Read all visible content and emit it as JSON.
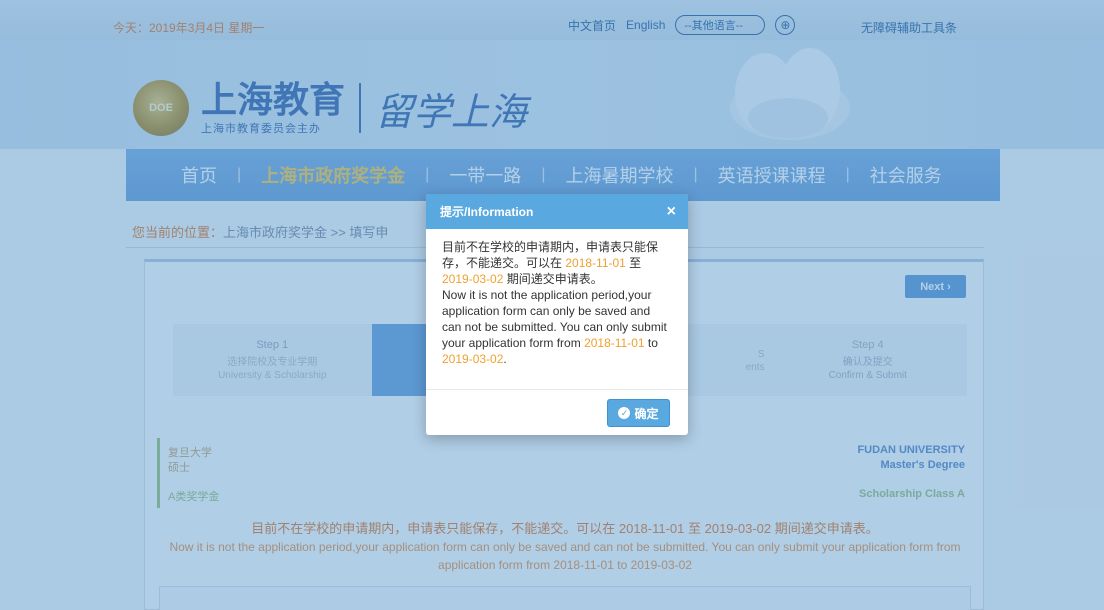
{
  "topbar": {
    "date": "今天：2019年3月4日 星期一",
    "home_cn": "中文首页",
    "english": "English",
    "other_lang": "--其他语言--",
    "accessible_tool": "无障碍辅助工具条"
  },
  "banner": {
    "emblem_text": "DOE",
    "logo_main": "上海教育",
    "logo_sub": "上海市教育委员会主办",
    "logo_script": "留学上海"
  },
  "nav": {
    "items": [
      "首页",
      "上海市政府奖学金",
      "一带一路",
      "上海暑期学校",
      "英语授课课程",
      "社会服务"
    ],
    "active_index": 1
  },
  "breadcrumb": {
    "label": "您当前的位置：",
    "path": "上海市政府奖学金 >> 填写申"
  },
  "panel": {
    "next_label": "Next ›",
    "steps": [
      {
        "title": "Step 1",
        "cn": "选择院校及专业学期",
        "en": "University & Scholarship"
      },
      {
        "title": "",
        "cn": "",
        "en": ""
      },
      {
        "title": "",
        "cn": "S",
        "en": "ents"
      },
      {
        "title": "Step 4",
        "cn": "确认及提交",
        "en": "Confirm & Submit"
      }
    ],
    "info": {
      "univ_cn": "复旦大学",
      "degree_cn": "硕士",
      "class_cn": "A类奖学金",
      "univ_en": "FUDAN UNIVERSITY",
      "degree_en": "Master's Degree",
      "class_en": "Scholarship Class A"
    },
    "notice_cn": "目前不在学校的申请期内，申请表只能保存，不能递交。可以在 2018-11-01 至 2019-03-02 期间递交申请表。",
    "notice_en_1": "Now it is not the application period,your application form can only be saved and can not be submitted. You can only submit your application form from",
    "notice_en_2": "application form from 2018-11-01 to 2019-03-02"
  },
  "modal": {
    "title": "提示/Information",
    "cn_1": "目前不在学校的申请期内，申请表只能保存，不能递交。可以在 ",
    "date_start": "2018-11-01",
    "cn_2": " 至 ",
    "date_end": "2019-03-02",
    "cn_3": " 期间递交申请表。",
    "en_1": "Now it is not the application period,your application form can only be saved and can not be submitted. You can only submit your application form from ",
    "en_date_start": "2018-11-01",
    "en_2": " to ",
    "en_date_end": "2019-03-02",
    "en_3": ".",
    "ok_label": "确定"
  },
  "colors": {
    "overlay": "#4a8ec8",
    "accent": "#5aa8e0",
    "highlight": "#f0a030"
  }
}
